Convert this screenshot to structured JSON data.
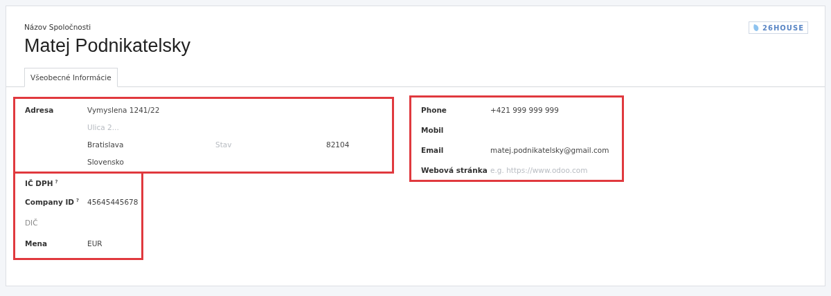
{
  "header": {
    "caption": "Názov Spoločnosti",
    "name": "Matej Podnikatelsky",
    "logo": "26HOUSE"
  },
  "tabs": [
    {
      "label": "Všeobecné Informácie",
      "selected": true
    }
  ],
  "address": {
    "label": "Adresa",
    "highlighted": true,
    "street": "Vymyslena 1241/22",
    "street2_placeholder": "Ulica 2...",
    "city": "Bratislava",
    "state_placeholder": "Stav",
    "zip": "82104",
    "country": "Slovensko"
  },
  "tax_fields": {
    "highlighted": true,
    "rows": [
      {
        "label": "IČ DPH",
        "help": "?",
        "muted": false
      },
      {
        "label": "Company ID",
        "help": "?",
        "value": "45645445678",
        "muted": false
      },
      {
        "label": "DIČ",
        "muted": true
      },
      {
        "label": "Mena",
        "value": "EUR",
        "muted": false
      }
    ]
  },
  "contact_fields": {
    "highlighted": true,
    "rows": [
      {
        "label": "Phone",
        "value": "+421 999 999 999"
      },
      {
        "label": "Mobil"
      },
      {
        "label": "Email",
        "value": "matej.podnikatelsky@gmail.com"
      },
      {
        "label": "Webová stránka",
        "placeholder": "e.g. https://www.odoo.com"
      }
    ]
  }
}
